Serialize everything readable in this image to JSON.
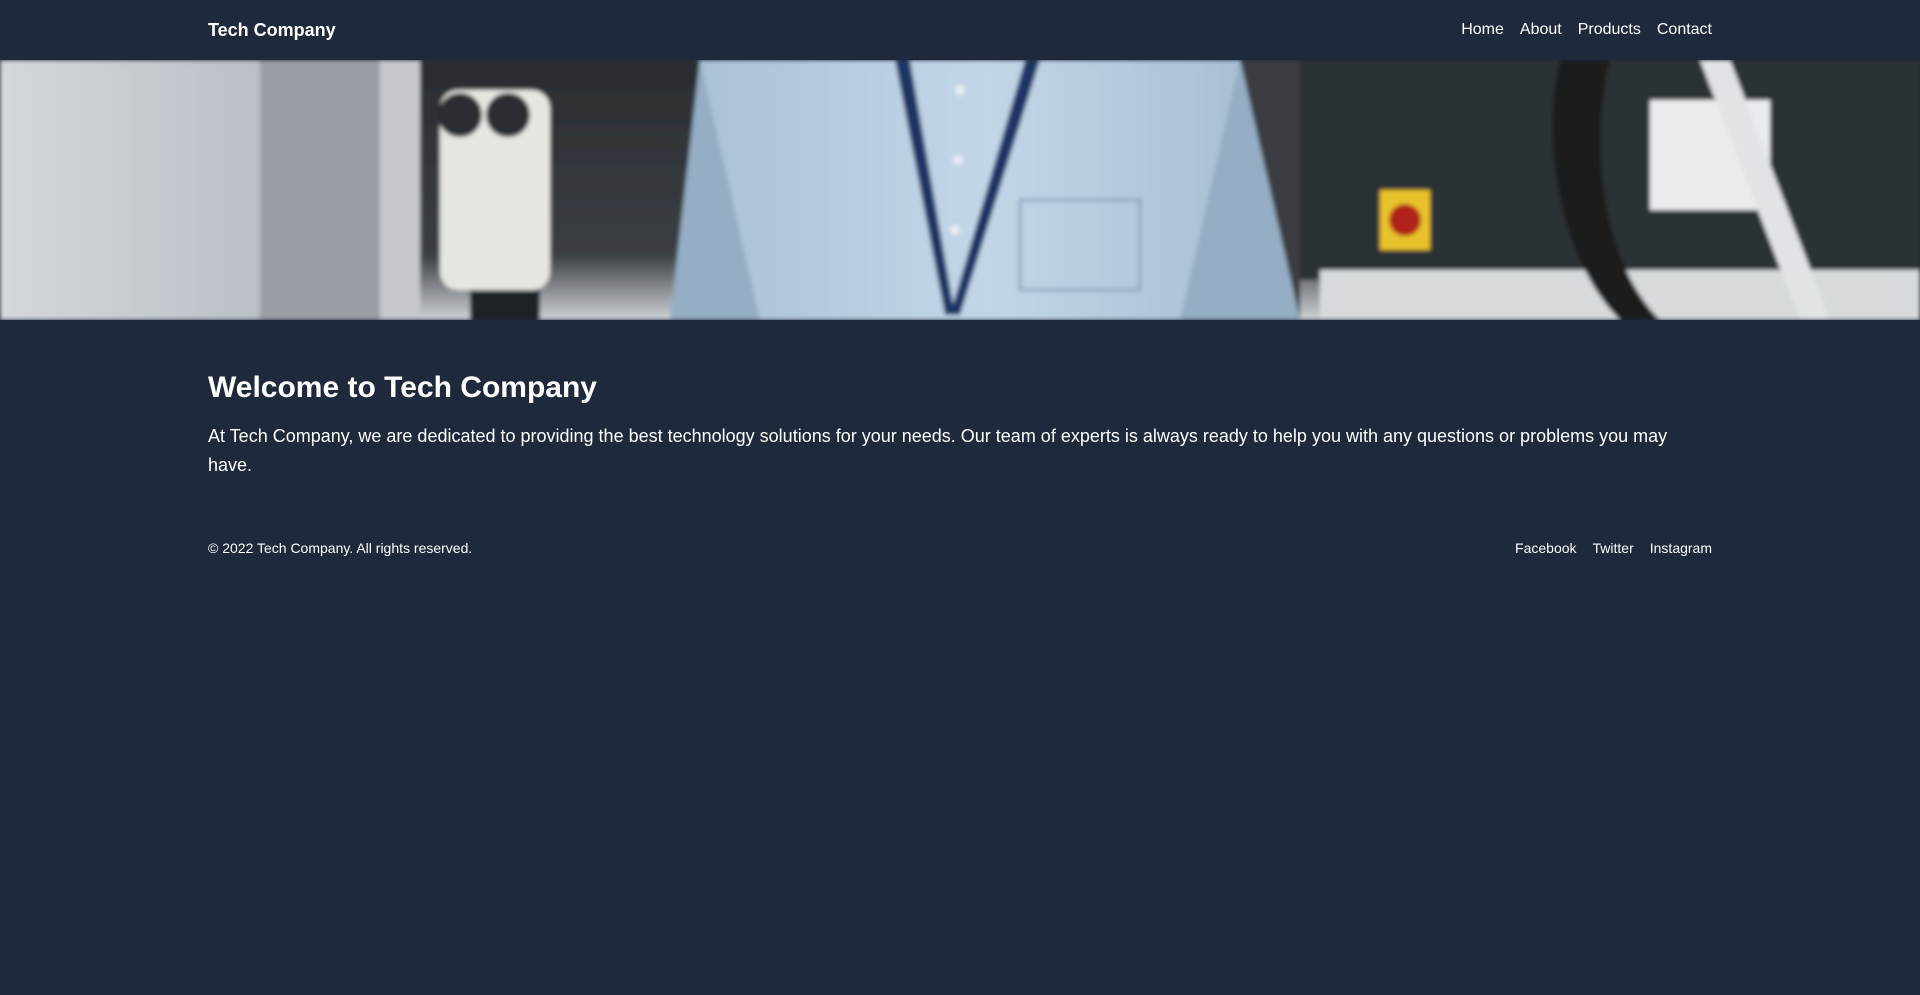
{
  "header": {
    "brand": "Tech Company",
    "nav": [
      {
        "label": "Home"
      },
      {
        "label": "About"
      },
      {
        "label": "Products"
      },
      {
        "label": "Contact"
      }
    ]
  },
  "hero": {
    "image": "person-in-lab-photo"
  },
  "main": {
    "title": "Welcome to Tech Company",
    "body": "At Tech Company, we are dedicated to providing the best technology solutions for your needs. Our team of experts is always ready to help you with any questions or problems you may have."
  },
  "footer": {
    "copyright": "© 2022 Tech Company. All rights reserved.",
    "social": [
      {
        "label": "Facebook"
      },
      {
        "label": "Twitter"
      },
      {
        "label": "Instagram"
      }
    ]
  },
  "colors": {
    "background": "#1e293b",
    "text": "#ffffff"
  }
}
